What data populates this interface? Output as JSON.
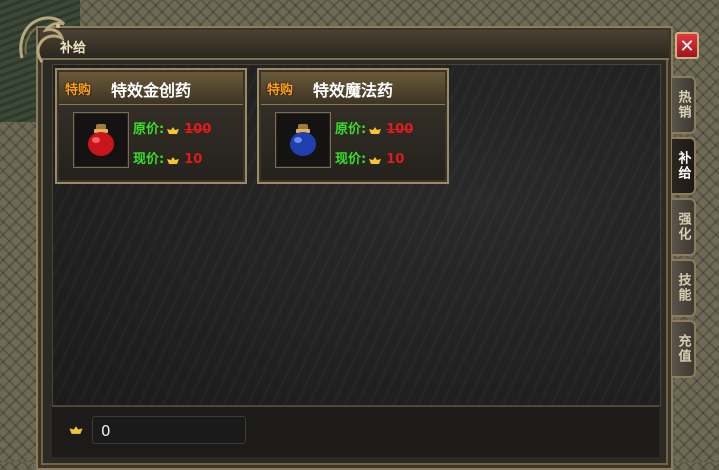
{
  "window": {
    "title": "补给",
    "close_label": "✕"
  },
  "items": [
    {
      "badge": "特购",
      "name": "特效金创药",
      "original_label": "原价:",
      "original_price": "100",
      "current_label": "现价:",
      "current_price": "10",
      "icon": "red-potion-icon"
    },
    {
      "badge": "特购",
      "name": "特效魔法药",
      "original_label": "原价:",
      "original_price": "100",
      "current_label": "现价:",
      "current_price": "10",
      "icon": "blue-potion-icon"
    }
  ],
  "tabs": [
    {
      "label": "热销",
      "active": false
    },
    {
      "label": "补给",
      "active": true
    },
    {
      "label": "强化",
      "active": false
    },
    {
      "label": "技能",
      "active": false
    },
    {
      "label": "充值",
      "active": false
    }
  ],
  "currency": {
    "icon": "gold-ingot-icon",
    "value": "0"
  },
  "colors": {
    "label_green": "#3adf2a",
    "price_red": "#e11b1b",
    "badge_orange": "#ff9f1a",
    "close_red": "#d1242a"
  }
}
